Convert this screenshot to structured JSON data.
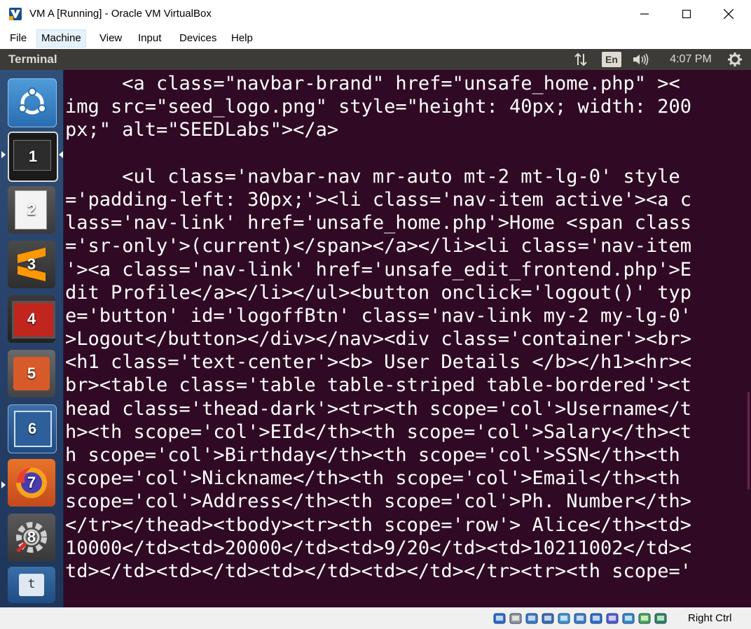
{
  "window": {
    "title": "VM A [Running] - Oracle VM VirtualBox",
    "controls": {
      "minimize": "minimize",
      "maximize": "maximize",
      "close": "close"
    }
  },
  "menubar": {
    "items": [
      {
        "label": "File"
      },
      {
        "label": "Machine"
      },
      {
        "label": "View"
      },
      {
        "label": "Input"
      },
      {
        "label": "Devices"
      },
      {
        "label": "Help"
      }
    ],
    "active_index": 1
  },
  "topbar": {
    "title": "Terminal",
    "keyboard_layout": "En",
    "clock": "4:07 PM",
    "icons": [
      "network-updown-icon",
      "keyboard-layout-icon",
      "volume-icon",
      "settings-gear-icon"
    ]
  },
  "launcher": {
    "items": [
      {
        "number": "",
        "icon": "ubuntu-dash-icon"
      },
      {
        "number": "1",
        "icon": "workspace-terminal-icon",
        "active": true
      },
      {
        "number": "2",
        "icon": "text-editor-icon"
      },
      {
        "number": "3",
        "icon": "sublime-text-icon"
      },
      {
        "number": "4",
        "icon": "system-monitor-icon"
      },
      {
        "number": "5",
        "icon": "file-manager-icon"
      },
      {
        "number": "6",
        "icon": "workspace-switcher-icon"
      },
      {
        "number": "7",
        "icon": "firefox-icon"
      },
      {
        "number": "8",
        "icon": "system-settings-icon"
      },
      {
        "number": "",
        "icon": "terminal-t-icon"
      }
    ]
  },
  "terminal": {
    "lines": [
      "     <a class=\"navbar-brand\" href=\"unsafe_home.php\" ><",
      "img src=\"seed_logo.png\" style=\"height: 40px; width: 200",
      "px;\" alt=\"SEEDLabs\"></a>",
      "",
      "     <ul class='navbar-nav mr-auto mt-2 mt-lg-0' style",
      "='padding-left: 30px;'><li class='nav-item active'><a c",
      "lass='nav-link' href='unsafe_home.php'>Home <span class",
      "='sr-only'>(current)</span></a></li><li class='nav-item",
      "'><a class='nav-link' href='unsafe_edit_frontend.php'>E",
      "dit Profile</a></li></ul><button onclick='logout()' typ",
      "e='button' id='logoffBtn' class='nav-link my-2 my-lg-0'",
      ">Logout</button></div></nav><div class='container'><br>",
      "<h1 class='text-center'><b> User Details </b></h1><hr><",
      "br><table class='table table-striped table-bordered'><t",
      "head class='thead-dark'><tr><th scope='col'>Username</t",
      "h><th scope='col'>EId</th><th scope='col'>Salary</th><t",
      "h scope='col'>Birthday</th><th scope='col'>SSN</th><th",
      "scope='col'>Nickname</th><th scope='col'>Email</th><th",
      "scope='col'>Address</th><th scope='col'>Ph. Number</th>",
      "</tr></thead><tbody><tr><th scope='row'> Alice</th><td>",
      "10000</td><td>20000</td><td>9/20</td><td>10211002</td><",
      "td></td><td></td><td></td><td></td></tr><tr><th scope='"
    ]
  },
  "statusbar": {
    "host_key": "Right Ctrl",
    "icons": [
      "hard-disk-icon",
      "optical-drive-icon",
      "audio-icon",
      "network-icon",
      "usb-icon",
      "shared-folders-icon",
      "display-icon",
      "video-capture-icon",
      "virtualization-icon",
      "mouse-integration-icon",
      "arrow-down-icon"
    ]
  }
}
